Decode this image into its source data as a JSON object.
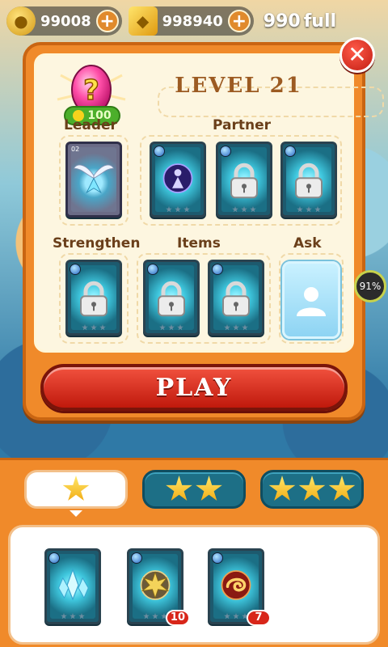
{
  "topbar": {
    "coins": "99008",
    "gems": "998940",
    "energy_value": "990",
    "energy_status": "full"
  },
  "dialog": {
    "level_title": "LEVEL 21",
    "egg_price": "100",
    "close_label": "✕",
    "sections": {
      "leader": "Leader",
      "partner": "Partner",
      "strengthen": "Strengthen",
      "items": "Items",
      "ask": "Ask"
    },
    "leader_card_level": "02",
    "play_label": "PLAY"
  },
  "side_badge": {
    "percent": "91%"
  },
  "bottom": {
    "tabs": [
      {
        "stars": 1,
        "active": true
      },
      {
        "stars": 2,
        "active": false
      },
      {
        "stars": 3,
        "active": false
      }
    ],
    "inventory": [
      {
        "kind": "ice-crystal",
        "count": ""
      },
      {
        "kind": "golden-leaf",
        "count": "10"
      },
      {
        "kind": "fire-swirl",
        "count": "7"
      }
    ]
  },
  "colors": {
    "panel_orange": "#f08a2a",
    "play_red": "#d8261a",
    "card_teal": "#1d6f86",
    "label_brown": "#6a3f1a"
  }
}
